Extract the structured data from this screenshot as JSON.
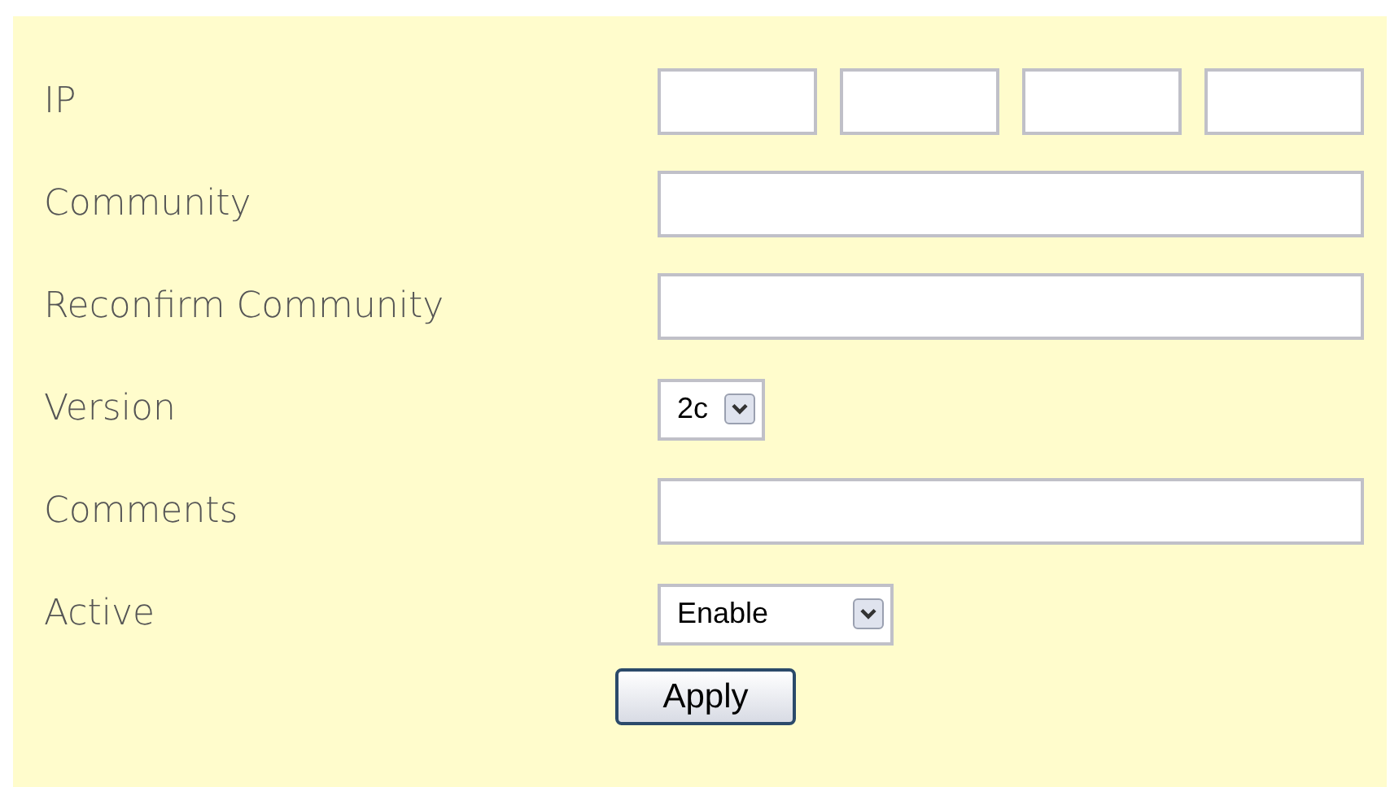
{
  "form": {
    "rows": [
      {
        "kind": "ip",
        "label": "IP"
      },
      {
        "kind": "text",
        "label": "Community"
      },
      {
        "kind": "text",
        "label": "Reconfirm Community"
      },
      {
        "kind": "select",
        "label": "Version",
        "value": "2c"
      },
      {
        "kind": "text",
        "label": "Comments"
      },
      {
        "kind": "select",
        "label": "Active",
        "value": "Enable"
      }
    ],
    "submit": "Apply"
  }
}
